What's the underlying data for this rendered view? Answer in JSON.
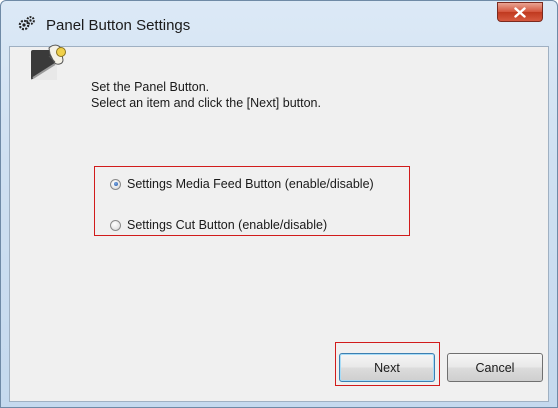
{
  "window": {
    "title": "Panel Button Settings",
    "title_icon": "gear-pair-icon",
    "close_icon": "close-icon",
    "colors": {
      "close_button": "#d4543b",
      "highlight_box": "#d11b1b"
    }
  },
  "instructions": {
    "line1": "Set the Panel Button.",
    "line2": "Select an item and click the [Next] button.",
    "icon": "wizard-hand-icon"
  },
  "options": [
    {
      "label": "Settings Media Feed Button (enable/disable)",
      "selected": true
    },
    {
      "label": "Settings Cut Button (enable/disable)",
      "selected": false
    }
  ],
  "buttons": {
    "next": "Next",
    "cancel": "Cancel"
  }
}
